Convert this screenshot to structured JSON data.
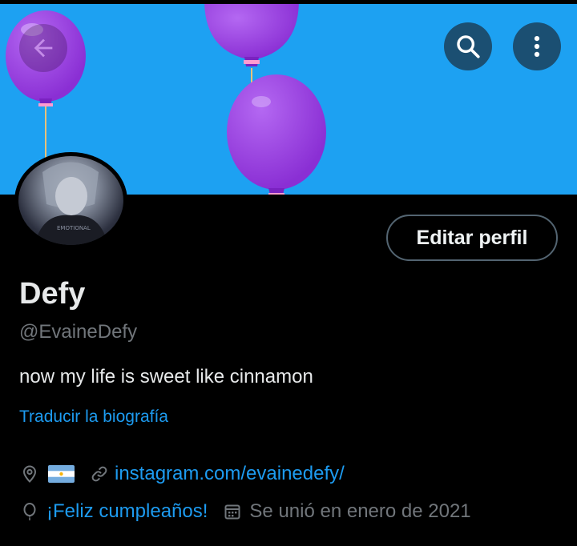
{
  "profile": {
    "name": "Defy",
    "handle": "@EvaineDefy",
    "bio": "now my life is sweet like cinnamon",
    "translate_label": "Traducir la biografía",
    "edit_button_label": "Editar perfil",
    "website": "instagram.com/evainedefy/",
    "birthday_text": "¡Feliz cumpleaños!",
    "joined_text": "Se unió en enero de 2021",
    "location_flag": "argentina-flag"
  },
  "header": {
    "banner_color": "#1da1f2",
    "balloon_color": "#9b3fe0",
    "icons": [
      "arrow-left-icon",
      "search-icon",
      "more-vertical-icon"
    ]
  },
  "colors": {
    "accent": "#1d9bf0",
    "secondary_text": "#71767b",
    "primary_text": "#e7e9ea"
  }
}
